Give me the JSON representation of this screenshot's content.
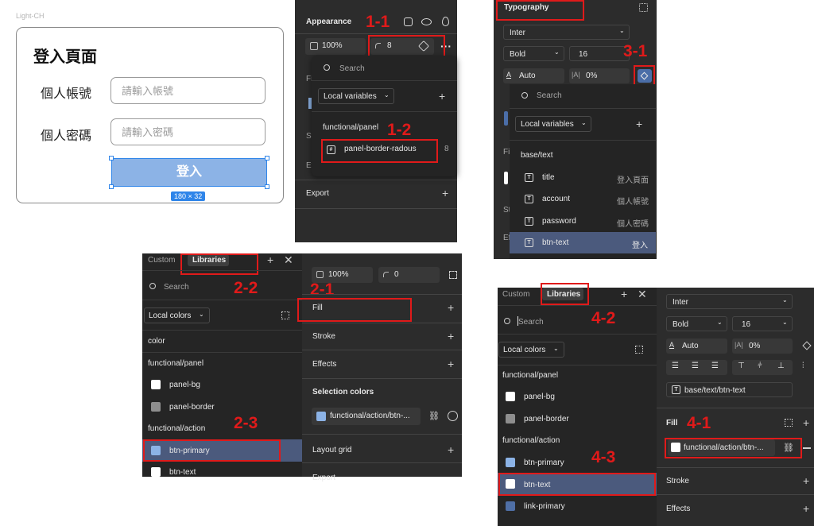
{
  "colors": {
    "panel_bg": "#2c2c2c",
    "highlight_row": "#4b5a7d",
    "btn_primary": "#8cb3e6",
    "selection_blue": "#2f85e9",
    "annotation_red": "#e01a1a",
    "panel_border_swatch": "#8e8e8e",
    "link_primary_swatch": "#4f6fa6"
  },
  "frame": {
    "label": "Light-CH",
    "title": "登入頁面",
    "account_label": "個人帳號",
    "account_placeholder": "請輸入帳號",
    "password_label": "個人密碼",
    "password_placeholder": "請輸入密碼",
    "login_button": "登入",
    "size_badge": "180 × 32"
  },
  "panel1": {
    "appearance": "Appearance",
    "opacity": "100%",
    "radius": "8",
    "search_placeholder": "Search",
    "local_variables": "Local variables",
    "group": "functional/panel",
    "variable_name": "panel-border-radous",
    "variable_value": "8",
    "partial_fi": "Fi",
    "partial_st": "St",
    "partial_ef": "Ef",
    "export": "Export",
    "tag_a": "1-1",
    "tag_b": "1-2"
  },
  "panel3": {
    "typography": "Typography",
    "font": "Inter",
    "weight": "Bold",
    "size": "16",
    "line_height": "Auto",
    "letter_spacing": "0%",
    "search_placeholder": "Search",
    "local_variables": "Local variables",
    "group": "base/text",
    "vars": [
      {
        "name": "title",
        "value": "登入頁面"
      },
      {
        "name": "account",
        "value": "個人帳號"
      },
      {
        "name": "password",
        "value": "個人密碼"
      },
      {
        "name": "btn-text",
        "value": "登入"
      }
    ],
    "partial_fi": "Fi",
    "partial_st": "St",
    "partial_ef": "Ef",
    "tag": "3-1"
  },
  "panel2": {
    "tab_custom": "Custom",
    "tab_libraries": "Libraries",
    "search_placeholder": "Search",
    "local_colors": "Local colors",
    "group_color": "color",
    "group_panel": "functional/panel",
    "panel_bg": "panel-bg",
    "panel_border": "panel-border",
    "group_action": "functional/action",
    "btn_primary": "btn-primary",
    "btn_text": "btn-text",
    "opacity": "100%",
    "radius": "0",
    "fill": "Fill",
    "stroke": "Stroke",
    "effects": "Effects",
    "selection_colors": "Selection colors",
    "selection_value": "functional/action/btn-...",
    "layout_grid": "Layout grid",
    "export_partial": "Export",
    "tag_a": "2-1",
    "tag_b": "2-2",
    "tag_c": "2-3"
  },
  "panel4": {
    "tab_custom": "Custom",
    "tab_libraries": "Libraries",
    "search_placeholder": "Search",
    "local_colors": "Local colors",
    "group_panel": "functional/panel",
    "panel_bg": "panel-bg",
    "panel_border": "panel-border",
    "group_action": "functional/action",
    "btn_primary": "btn-primary",
    "btn_text": "btn-text",
    "link_primary": "link-primary",
    "font": "Inter",
    "weight": "Bold",
    "size": "16",
    "line_height": "Auto",
    "letter_spacing": "0%",
    "text_style": "base/text/btn-text",
    "fill": "Fill",
    "fill_value": "functional/action/btn-...",
    "stroke": "Stroke",
    "effects": "Effects",
    "tag_a": "4-1",
    "tag_b": "4-2",
    "tag_c": "4-3"
  }
}
